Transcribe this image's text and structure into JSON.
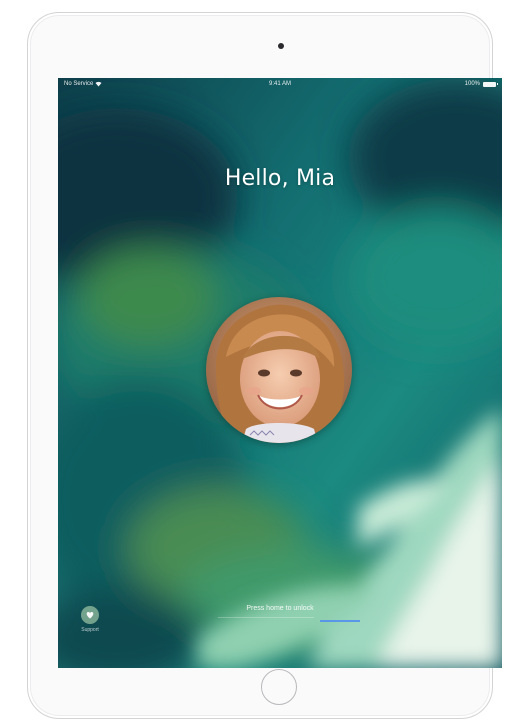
{
  "status_bar": {
    "carrier": "No Service",
    "time": "9:41 AM",
    "battery": "100%"
  },
  "lock_screen": {
    "greeting": "Hello, Mia",
    "unlock_hint": "Press home to unlock",
    "corner_label": "Support"
  },
  "icons": {
    "wifi": "wifi-icon",
    "battery": "battery-icon",
    "camera": "camera-icon",
    "home": "home-button",
    "corner": "heart-icon"
  },
  "colors": {
    "wallpaper_dark": "#0b4a52",
    "wallpaper_teal": "#1a8a86",
    "wallpaper_light": "#bfe6d2",
    "device_frame": "#fafafa"
  }
}
